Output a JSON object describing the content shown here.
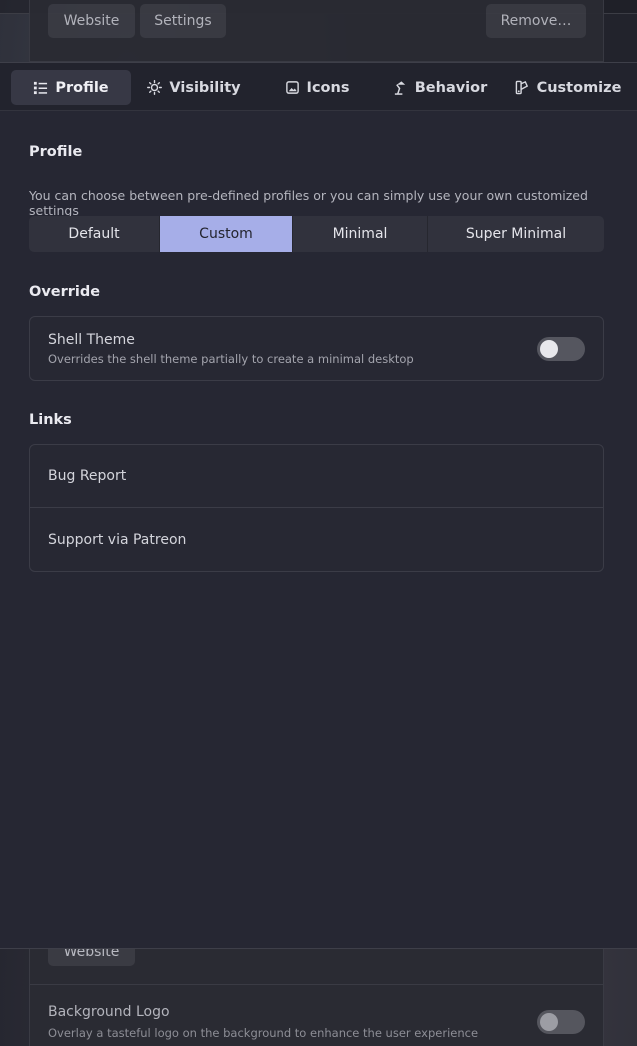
{
  "background": {
    "top_buttons": {
      "website": "Website",
      "settings": "Settings",
      "remove": "Remove…"
    },
    "bottom": {
      "website": "Website",
      "setting_title": "Background Logo",
      "setting_desc": "Overlay a tasteful logo on the background to enhance the user experience"
    }
  },
  "tabs": [
    {
      "label": "Profile",
      "icon": "list-icon",
      "active": true
    },
    {
      "label": "Visibility",
      "icon": "sun-icon",
      "active": false
    },
    {
      "label": "Icons",
      "icon": "image-icon",
      "active": false
    },
    {
      "label": "Behavior",
      "icon": "desk-lamp-icon",
      "active": false
    },
    {
      "label": "Customize",
      "icon": "palette-icon",
      "active": false
    }
  ],
  "profile": {
    "title": "Profile",
    "description": "You can choose between pre-defined profiles or you can simply use your own customized settings",
    "options": [
      "Default",
      "Custom",
      "Minimal",
      "Super Minimal"
    ],
    "selected": "Custom"
  },
  "override": {
    "title": "Override",
    "shell_theme": {
      "title": "Shell Theme",
      "desc": "Overrides the shell theme partially to create a minimal desktop",
      "enabled": false
    }
  },
  "links": {
    "title": "Links",
    "items": [
      "Bug Report",
      "Support via Patreon"
    ]
  },
  "colors": {
    "accent": "#a6aee8",
    "panel": "#262733"
  }
}
